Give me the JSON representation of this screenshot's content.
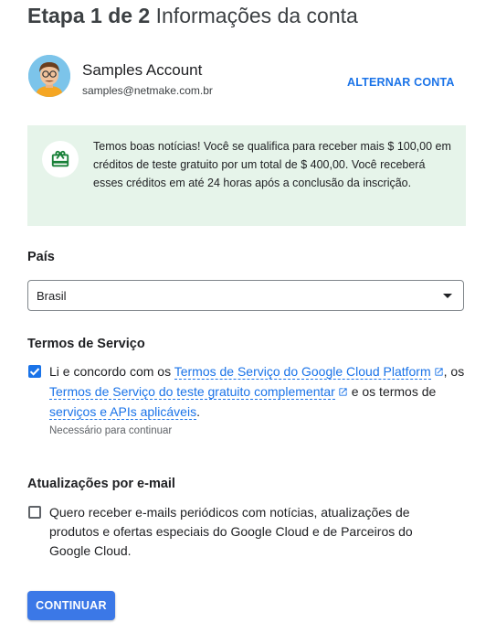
{
  "header": {
    "step": "Etapa 1 de 2",
    "title": "Informações da conta"
  },
  "account": {
    "name": "Samples Account",
    "email": "samples@netmake.com.br",
    "switch_label": "ALTERNAR CONTA"
  },
  "banner": {
    "icon": "gift-icon",
    "text": "Temos boas notícias! Você se qualifica para receber mais $ 100,00 em créditos de teste gratuito por um total de $ 400,00. Você receberá esses créditos em até 24 horas após a conclusão da inscrição.",
    "bg_color": "#e6f4ea",
    "icon_color": "#188038"
  },
  "country": {
    "label": "País",
    "selected": "Brasil"
  },
  "terms": {
    "label": "Termos de Serviço",
    "checked": true,
    "text_1": "Li e concordo com os ",
    "link_1": "Termos de Serviço do Google Cloud Platform",
    "text_2": ", os ",
    "link_2": "Termos de Serviço do teste gratuito complementar",
    "text_3": " e os termos de ",
    "link_3": "serviços e APIs aplicáveis",
    "text_4": ".",
    "required_note": "Necessário para continuar"
  },
  "email_updates": {
    "label": "Atualizações por e-mail",
    "checked": false,
    "text": "Quero receber e-mails periódicos com notícias, atualizações de produtos e ofertas especiais do Google Cloud e de Parceiros do Google Cloud."
  },
  "actions": {
    "continue_label": "CONTINUAR",
    "accent_color": "#1a73e8"
  }
}
